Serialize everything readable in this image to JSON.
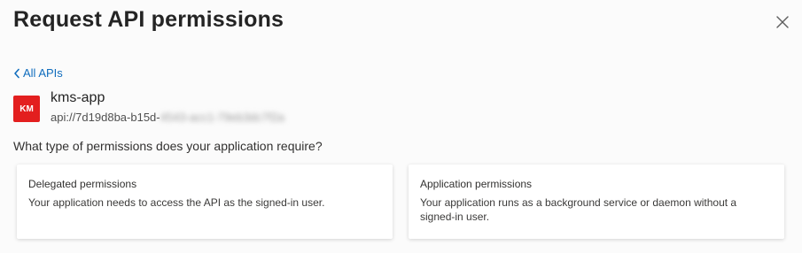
{
  "dialog": {
    "title": "Request API permissions",
    "close_icon": "close-icon"
  },
  "back_link": {
    "icon": "chevron-left-icon",
    "label": "All APIs"
  },
  "api": {
    "avatar_text": "KM",
    "avatar_color": "#e31f1f",
    "name": "kms-app",
    "uri_visible": "api://7d19d8ba-b15d-",
    "uri_blurred": "4543-acc1-79eb3dc7f2a"
  },
  "question": "What type of permissions does your application require?",
  "permission_types": [
    {
      "title": "Delegated permissions",
      "description": "Your application needs to access the API as the signed-in user."
    },
    {
      "title": "Application permissions",
      "description": "Your application runs as a background service or daemon without a signed-in user."
    }
  ],
  "colors": {
    "link": "#0f6cbd",
    "text": "#323130"
  }
}
